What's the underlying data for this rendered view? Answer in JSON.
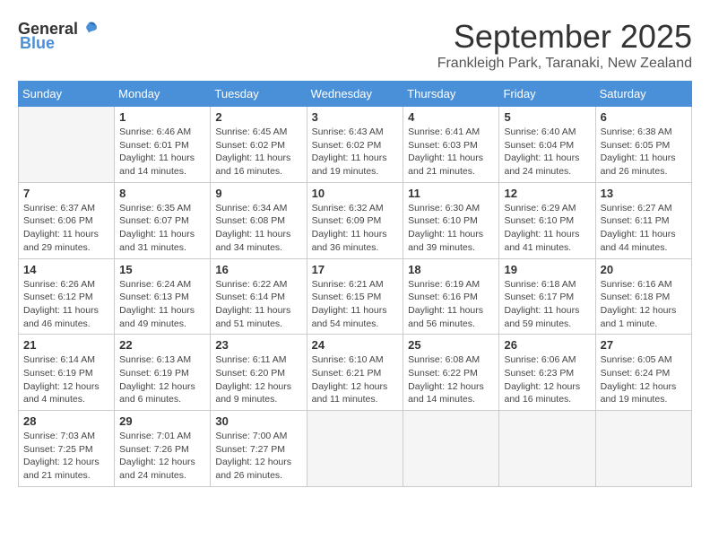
{
  "logo": {
    "general": "General",
    "blue": "Blue"
  },
  "title": "September 2025",
  "location": "Frankleigh Park, Taranaki, New Zealand",
  "days_of_week": [
    "Sunday",
    "Monday",
    "Tuesday",
    "Wednesday",
    "Thursday",
    "Friday",
    "Saturday"
  ],
  "weeks": [
    [
      {
        "day": "",
        "info": ""
      },
      {
        "day": "1",
        "info": "Sunrise: 6:46 AM\nSunset: 6:01 PM\nDaylight: 11 hours and 14 minutes."
      },
      {
        "day": "2",
        "info": "Sunrise: 6:45 AM\nSunset: 6:02 PM\nDaylight: 11 hours and 16 minutes."
      },
      {
        "day": "3",
        "info": "Sunrise: 6:43 AM\nSunset: 6:02 PM\nDaylight: 11 hours and 19 minutes."
      },
      {
        "day": "4",
        "info": "Sunrise: 6:41 AM\nSunset: 6:03 PM\nDaylight: 11 hours and 21 minutes."
      },
      {
        "day": "5",
        "info": "Sunrise: 6:40 AM\nSunset: 6:04 PM\nDaylight: 11 hours and 24 minutes."
      },
      {
        "day": "6",
        "info": "Sunrise: 6:38 AM\nSunset: 6:05 PM\nDaylight: 11 hours and 26 minutes."
      }
    ],
    [
      {
        "day": "7",
        "info": "Sunrise: 6:37 AM\nSunset: 6:06 PM\nDaylight: 11 hours and 29 minutes."
      },
      {
        "day": "8",
        "info": "Sunrise: 6:35 AM\nSunset: 6:07 PM\nDaylight: 11 hours and 31 minutes."
      },
      {
        "day": "9",
        "info": "Sunrise: 6:34 AM\nSunset: 6:08 PM\nDaylight: 11 hours and 34 minutes."
      },
      {
        "day": "10",
        "info": "Sunrise: 6:32 AM\nSunset: 6:09 PM\nDaylight: 11 hours and 36 minutes."
      },
      {
        "day": "11",
        "info": "Sunrise: 6:30 AM\nSunset: 6:10 PM\nDaylight: 11 hours and 39 minutes."
      },
      {
        "day": "12",
        "info": "Sunrise: 6:29 AM\nSunset: 6:10 PM\nDaylight: 11 hours and 41 minutes."
      },
      {
        "day": "13",
        "info": "Sunrise: 6:27 AM\nSunset: 6:11 PM\nDaylight: 11 hours and 44 minutes."
      }
    ],
    [
      {
        "day": "14",
        "info": "Sunrise: 6:26 AM\nSunset: 6:12 PM\nDaylight: 11 hours and 46 minutes."
      },
      {
        "day": "15",
        "info": "Sunrise: 6:24 AM\nSunset: 6:13 PM\nDaylight: 11 hours and 49 minutes."
      },
      {
        "day": "16",
        "info": "Sunrise: 6:22 AM\nSunset: 6:14 PM\nDaylight: 11 hours and 51 minutes."
      },
      {
        "day": "17",
        "info": "Sunrise: 6:21 AM\nSunset: 6:15 PM\nDaylight: 11 hours and 54 minutes."
      },
      {
        "day": "18",
        "info": "Sunrise: 6:19 AM\nSunset: 6:16 PM\nDaylight: 11 hours and 56 minutes."
      },
      {
        "day": "19",
        "info": "Sunrise: 6:18 AM\nSunset: 6:17 PM\nDaylight: 11 hours and 59 minutes."
      },
      {
        "day": "20",
        "info": "Sunrise: 6:16 AM\nSunset: 6:18 PM\nDaylight: 12 hours and 1 minute."
      }
    ],
    [
      {
        "day": "21",
        "info": "Sunrise: 6:14 AM\nSunset: 6:19 PM\nDaylight: 12 hours and 4 minutes."
      },
      {
        "day": "22",
        "info": "Sunrise: 6:13 AM\nSunset: 6:19 PM\nDaylight: 12 hours and 6 minutes."
      },
      {
        "day": "23",
        "info": "Sunrise: 6:11 AM\nSunset: 6:20 PM\nDaylight: 12 hours and 9 minutes."
      },
      {
        "day": "24",
        "info": "Sunrise: 6:10 AM\nSunset: 6:21 PM\nDaylight: 12 hours and 11 minutes."
      },
      {
        "day": "25",
        "info": "Sunrise: 6:08 AM\nSunset: 6:22 PM\nDaylight: 12 hours and 14 minutes."
      },
      {
        "day": "26",
        "info": "Sunrise: 6:06 AM\nSunset: 6:23 PM\nDaylight: 12 hours and 16 minutes."
      },
      {
        "day": "27",
        "info": "Sunrise: 6:05 AM\nSunset: 6:24 PM\nDaylight: 12 hours and 19 minutes."
      }
    ],
    [
      {
        "day": "28",
        "info": "Sunrise: 7:03 AM\nSunset: 7:25 PM\nDaylight: 12 hours and 21 minutes."
      },
      {
        "day": "29",
        "info": "Sunrise: 7:01 AM\nSunset: 7:26 PM\nDaylight: 12 hours and 24 minutes."
      },
      {
        "day": "30",
        "info": "Sunrise: 7:00 AM\nSunset: 7:27 PM\nDaylight: 12 hours and 26 minutes."
      },
      {
        "day": "",
        "info": ""
      },
      {
        "day": "",
        "info": ""
      },
      {
        "day": "",
        "info": ""
      },
      {
        "day": "",
        "info": ""
      }
    ]
  ]
}
